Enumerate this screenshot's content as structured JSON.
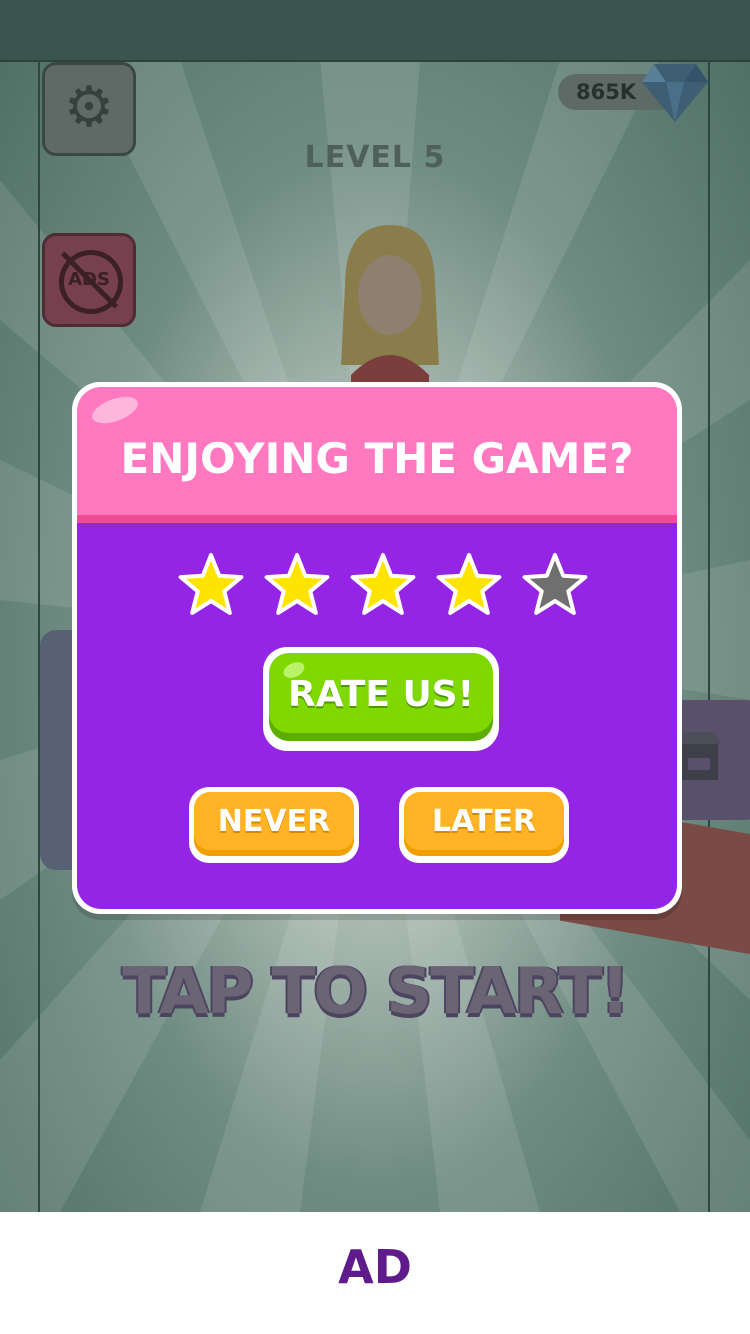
{
  "hud": {
    "currency_amount": "865K",
    "level_label": "LEVEL 5",
    "tap_prompt": "TAP TO START!",
    "ads_badge_text": "ADS"
  },
  "dialog": {
    "title": "ENJOYING THE GAME?",
    "rating": {
      "filled": 4,
      "total": 5
    },
    "rate_button": "RATE US!",
    "never_button": "NEVER",
    "later_button": "LATER"
  },
  "ad_banner": {
    "label": "AD"
  },
  "colors": {
    "dialog_header": "#ff78c0",
    "dialog_body": "#9525e4",
    "rate_button": "#7fd800",
    "secondary_buttons": "#ffb325",
    "star_filled": "#ffe400",
    "star_empty": "#6f6f6f",
    "ad_text": "#5f1a8c"
  },
  "icons": [
    "gear-icon",
    "no-ads-icon",
    "diamond-icon",
    "star-icon",
    "shop-icon"
  ]
}
